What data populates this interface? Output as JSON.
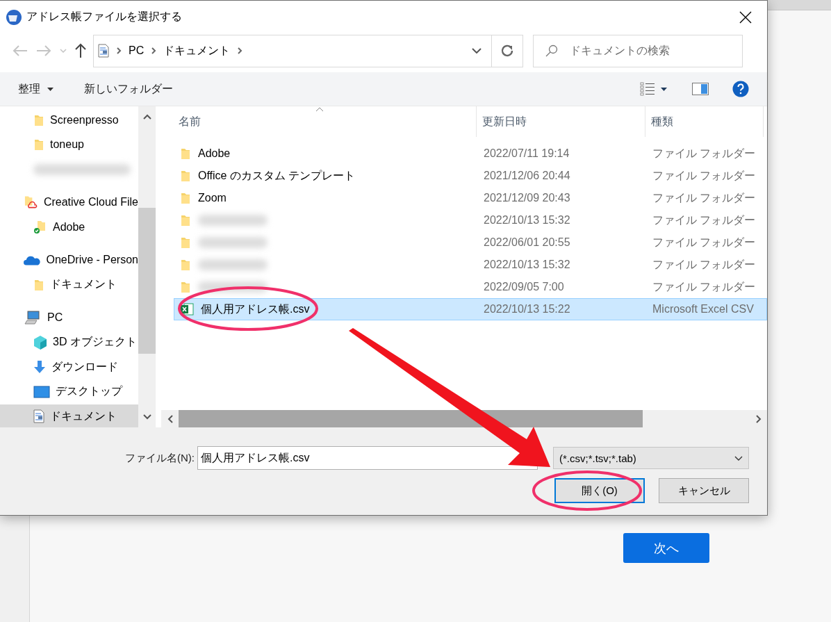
{
  "window": {
    "title": "アドレス帳ファイルを選択する"
  },
  "breadcrumb": [
    "PC",
    "ドキュメント"
  ],
  "search": {
    "placeholder": "ドキュメントの検索"
  },
  "toolbar": {
    "organize": "整理",
    "new_folder": "新しいフォルダー"
  },
  "sidebar": {
    "items": [
      {
        "kind": "folder",
        "label": "Screenpresso",
        "selected": false
      },
      {
        "kind": "folder",
        "label": "toneup",
        "selected": false
      },
      {
        "kind": "hidden",
        "selected": false
      },
      {
        "kind": "creative-cloud",
        "label": "Creative Cloud File",
        "selected": false,
        "children": [
          {
            "kind": "synced-folder",
            "label": "Adobe",
            "selected": false
          }
        ]
      },
      {
        "kind": "onedrive",
        "label": "OneDrive - Person",
        "selected": false,
        "children": [
          {
            "kind": "folder",
            "label": "ドキュメント",
            "selected": false
          }
        ]
      },
      {
        "kind": "pc",
        "label": "PC",
        "selected": false,
        "children": [
          {
            "kind": "objects3d",
            "label": "3D オブジェクト",
            "selected": false
          },
          {
            "kind": "download",
            "label": "ダウンロード",
            "selected": false
          },
          {
            "kind": "desktop",
            "label": "デスクトップ",
            "selected": false
          },
          {
            "kind": "document",
            "label": "ドキュメント",
            "selected": true
          }
        ]
      }
    ]
  },
  "table": {
    "columns": [
      "名前",
      "更新日時",
      "種類"
    ],
    "rows": [
      {
        "kind": "folder",
        "name": "Adobe",
        "date": "2022/07/11 19:14",
        "type": "ファイル フォルダー",
        "selected": false
      },
      {
        "kind": "folder",
        "name": "Office のカスタム テンプレート",
        "date": "2021/12/06 20:44",
        "type": "ファイル フォルダー",
        "selected": false
      },
      {
        "kind": "folder",
        "name": "Zoom",
        "date": "2021/12/09 20:43",
        "type": "ファイル フォルダー",
        "selected": false
      },
      {
        "kind": "folder",
        "date": "2022/10/13 15:32",
        "type": "ファイル フォルダー",
        "selected": false
      },
      {
        "kind": "folder",
        "date": "2022/06/01 20:55",
        "type": "ファイル フォルダー",
        "selected": false
      },
      {
        "kind": "folder",
        "date": "2022/10/13 15:32",
        "type": "ファイル フォルダー",
        "selected": false
      },
      {
        "kind": "folder",
        "date": "2022/09/05 7:00",
        "type": "ファイル フォルダー",
        "selected": false
      },
      {
        "kind": "excel",
        "name": "個人用アドレス帳.csv",
        "date": "2022/10/13 15:22",
        "type": "Microsoft Excel CSV",
        "selected": true
      }
    ]
  },
  "file_name": {
    "label": "ファイル名(N):",
    "value": "個人用アドレス帳.csv"
  },
  "file_type": "(*.csv;*.tsv;*.tab)",
  "buttons": [
    {
      "kind": "default",
      "label": "開く(O)"
    },
    {
      "kind": "normal",
      "label": "キャンセル"
    }
  ],
  "page": {
    "next_button": "次へ"
  }
}
